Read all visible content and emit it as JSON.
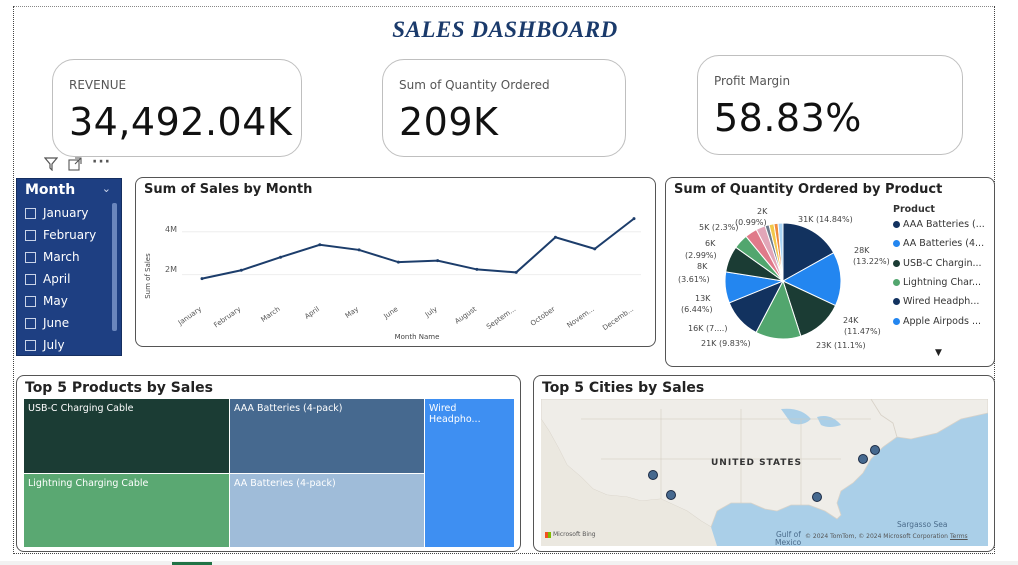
{
  "title": "SALES DASHBOARD",
  "kpis": {
    "revenue": {
      "label": "REVENUE",
      "value": "34,492.04K"
    },
    "quantity": {
      "label": "Sum of Quantity Ordered",
      "value": "209K"
    },
    "margin": {
      "label": "Profit Margin",
      "value": "58.83%"
    }
  },
  "slicer": {
    "header": "Month",
    "items": [
      "January",
      "February",
      "March",
      "April",
      "May",
      "June",
      "July"
    ]
  },
  "icons": {
    "filter": "filter-icon",
    "focus": "focus-mode-icon",
    "more": "more-options-icon"
  },
  "colors": {
    "navy": "#1e3f82",
    "line": "#1c3d6b"
  },
  "line_chart": {
    "title": "Sum of Sales by Month",
    "xlabel": "Month Name",
    "ylabel": "Sum of Sales",
    "y_ticks": [
      "4M",
      "2M"
    ]
  },
  "pie_chart": {
    "title": "Sum of Quantity Ordered by Product",
    "legend_title": "Product",
    "legend": [
      "AAA Batteries (...",
      "AA Batteries (4...",
      "USB-C Chargin...",
      "Lightning Char...",
      "Wired Headph...",
      "Apple Airpods ..."
    ],
    "labels": [
      "31K (14.84%)",
      "28K",
      "(13.22%)",
      "24K",
      "(11.47%)",
      "23K (11.1%)",
      "21K (9.83%)",
      "16K (7....)",
      "13K",
      "(6.44%)",
      "8K",
      "(3.61%)",
      "6K",
      "(2.99%)",
      "5K (2.3%)",
      "(0.99%)",
      "2K"
    ]
  },
  "treemap": {
    "title": "Top 5 Products by Sales",
    "items": [
      "USB-C Charging Cable",
      "AAA Batteries (4-pack)",
      "Wired Headpho...",
      "Lightning Charging Cable",
      "AA Batteries (4-pack)"
    ]
  },
  "map": {
    "title": "Top 5 Cities by Sales",
    "country_label": "UNITED STATES",
    "sea_label": "Sargasso Sea",
    "gulf_label": "Gulf of",
    "mexico_label": "Mexico",
    "bing": "Microsoft Bing",
    "copyright": "© 2024 TomTom, © 2024 Microsoft Corporation",
    "terms": "Terms"
  },
  "chart_data": [
    {
      "type": "line",
      "title": "Sum of Sales by Month",
      "xlabel": "Month Name",
      "ylabel": "Sum of Sales",
      "categories": [
        "January",
        "February",
        "March",
        "April",
        "May",
        "June",
        "July",
        "August",
        "Septem...",
        "October",
        "Novem...",
        "Decemb..."
      ],
      "values": [
        1.81,
        2.2,
        2.81,
        3.39,
        3.15,
        2.58,
        2.65,
        2.24,
        2.1,
        3.74,
        3.2,
        4.61
      ],
      "y_tick_values": [
        2,
        4
      ],
      "ylim": [
        1.0,
        5.2
      ],
      "unit": "M"
    },
    {
      "type": "pie",
      "title": "Sum of Quantity Ordered by Product",
      "slices": [
        {
          "name": "AAA Batteries (...",
          "value": 14.84,
          "color": "#12325f"
        },
        {
          "name": "AA Batteries (4...",
          "value": 13.22,
          "color": "#2386f0"
        },
        {
          "name": "USB-C Chargin...",
          "value": 11.47,
          "color": "#1b3c34"
        },
        {
          "name": "Lightning Char...",
          "value": 11.1,
          "color": "#52a66e"
        },
        {
          "name": "Wired Headph...",
          "value": 9.83,
          "color": "#12325f"
        },
        {
          "name": "Apple Airpods ...",
          "value": 7.6,
          "color": "#2386f0"
        },
        {
          "name": "",
          "value": 6.44,
          "color": "#1b3c34"
        },
        {
          "name": "",
          "value": 3.61,
          "color": "#52a66e"
        },
        {
          "name": "",
          "value": 2.99,
          "color": "#e07a8a"
        },
        {
          "name": "",
          "value": 2.3,
          "color": "#e2a6b8"
        },
        {
          "name": "",
          "value": 0.99,
          "color": "#6b7a8c"
        },
        {
          "name": "",
          "value": 1.2,
          "color": "#f2c84b"
        },
        {
          "name": "",
          "value": 1.0,
          "color": "#f08a3c"
        },
        {
          "name": "",
          "value": 1.2,
          "color": "#a9d4f5"
        }
      ]
    }
  ]
}
